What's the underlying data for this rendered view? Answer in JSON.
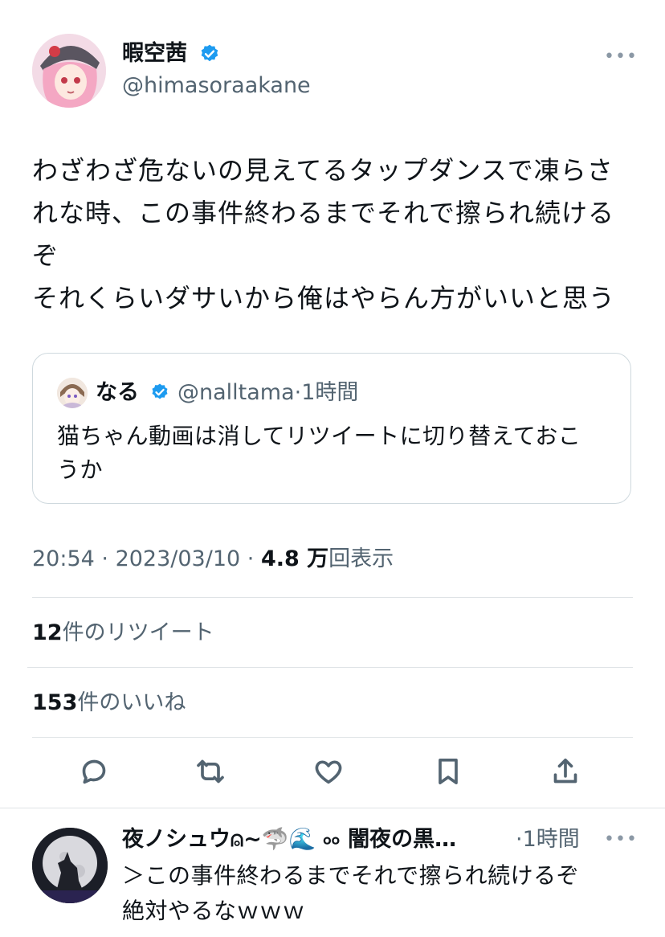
{
  "author": {
    "display_name": "暇空茜",
    "handle": "@himasoraakane",
    "more": "•••"
  },
  "tweet": {
    "lines": [
      "わざわざ危ないの見えてるタップダンスで凍らさ",
      "れな時、この事件終わるまでそれで擦られ続ける",
      "ぞ",
      "それくらいダサいから俺はやらん方がいいと思う"
    ]
  },
  "quote": {
    "display_name": "なる",
    "handle": "@nalltama",
    "separator": "·",
    "time": "1時間",
    "lines": [
      "猫ちゃん動画は消してリツイートに切り替えておこ",
      "うか"
    ]
  },
  "meta": {
    "time": "20:54",
    "dot1": " · ",
    "date": "2023/03/10",
    "dot2": " · ",
    "views": "4.8 万",
    "views_label": "回表示"
  },
  "stats": {
    "retweets_count": "12",
    "retweets_label": "件のリツイート",
    "likes_count": "153",
    "likes_label": "件のいいね"
  },
  "actions": [
    "reply-icon",
    "retweet-icon",
    "like-icon",
    "bookmark-icon",
    "share-icon"
  ],
  "reply": {
    "display_name": "夜ノシュウ⍝~🦈🌊 ৹৹ 闇夜の黒…",
    "time": "·1時間",
    "more": "•••",
    "lines": [
      "＞この事件終わるまでそれで擦られ続けるぞ",
      "絶対やるなｗｗｗ"
    ]
  },
  "colors": {
    "verified": "#1d9bf0",
    "muted": "#536471",
    "text": "#0f1419",
    "border": "#cfd9de"
  }
}
